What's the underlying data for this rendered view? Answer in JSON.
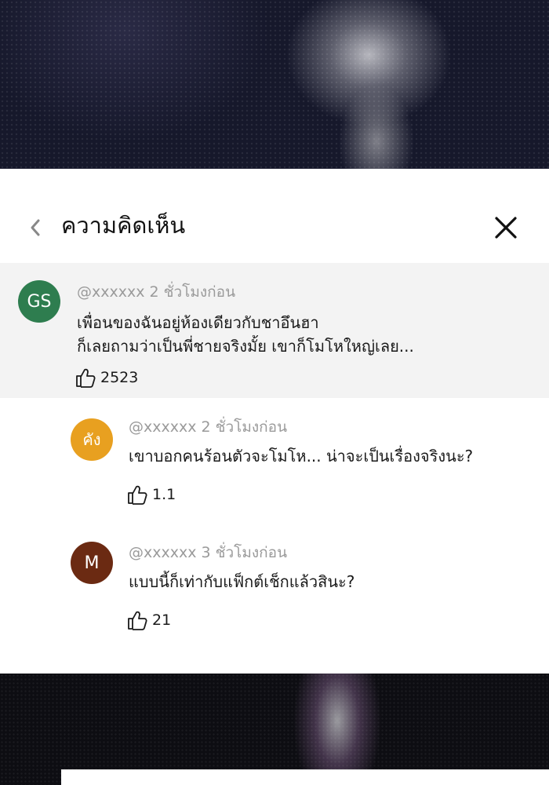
{
  "header": {
    "title": "ความคิดเห็น",
    "back_icon": "chevron-left-icon",
    "close_icon": "close-icon"
  },
  "main_comment": {
    "avatar_text": "GS",
    "avatar_color": "#2e7d4f",
    "username": "@xxxxxx",
    "time": "2 ชั่วโมงก่อน",
    "body_line1": "เพื่อนของฉันอยู่ห้องเดียวกับชาอึนฮา",
    "body_line2": "ก็เลยถามว่าเป็นพี่ชายจริงมั้ย เขาก็โมโหใหญ่เลย...",
    "likes": "2523",
    "like_icon": "thumbs-up-icon"
  },
  "replies": [
    {
      "avatar_text": "คัง",
      "avatar_color": "#e8a020",
      "username": "@xxxxxx",
      "time": "2 ชั่วโมงก่อน",
      "body": "เขาบอกคนร้อนตัวจะโมโห... น่าจะเป็นเรื่องจริงนะ?",
      "likes": "1.1"
    },
    {
      "avatar_text": "M",
      "avatar_color": "#6b2a12",
      "username": "@xxxxxx",
      "time": "3 ชั่วโมงก่อน",
      "body": "แบบนี้ก็เท่ากับแฟ็กต์เช็กแล้วสินะ?",
      "likes": "21"
    }
  ]
}
